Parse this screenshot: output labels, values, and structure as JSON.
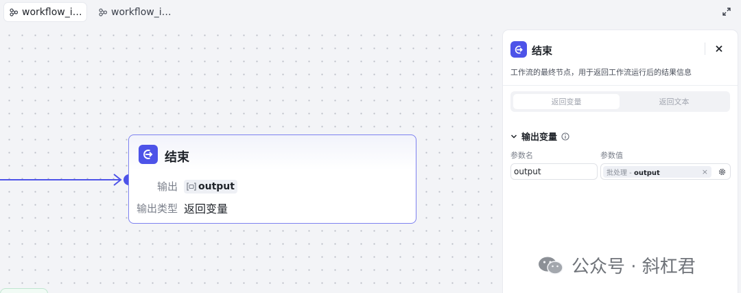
{
  "tabs": [
    {
      "label": "workflow_i…",
      "active": true
    },
    {
      "label": "workflow_i…",
      "active": false
    }
  ],
  "node": {
    "title": "结束",
    "output_label": "输出",
    "output_var": "output",
    "type_label": "输出类型",
    "type_value": "返回变量"
  },
  "panel": {
    "title": "结束",
    "description": "工作流的最终节点，用于返回工作流运行后的结果信息",
    "segments": [
      "返回变量",
      "返回文本"
    ],
    "selected_segment": "返回变量",
    "section_title": "输出变量",
    "col_name": "参数名",
    "col_value": "参数值",
    "param_name": "output",
    "param_value_prefix": "批处理 -",
    "param_value_var": "output"
  },
  "watermark": {
    "text": "公众号 · 斜杠君"
  },
  "colors": {
    "accent": "#4d53e8",
    "node_border": "#7c80f0"
  }
}
